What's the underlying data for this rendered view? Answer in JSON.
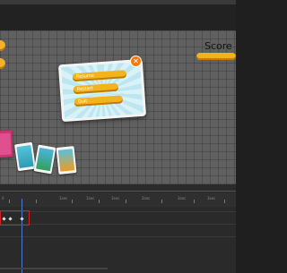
{
  "stage": {
    "score_label": "Score",
    "dialog_buttons": [
      "Resume",
      "Restart",
      "Quit"
    ],
    "close_glyph": "✕"
  },
  "timeline": {
    "ruler_labels": [
      "0",
      "1sec",
      "1sec",
      "1sec",
      "2sec",
      "3sec",
      "3sec"
    ]
  },
  "colors": {
    "accent_orange": "#f3b31a",
    "playhead_blue": "#4a7bd1",
    "selection_red": "#d02020"
  }
}
